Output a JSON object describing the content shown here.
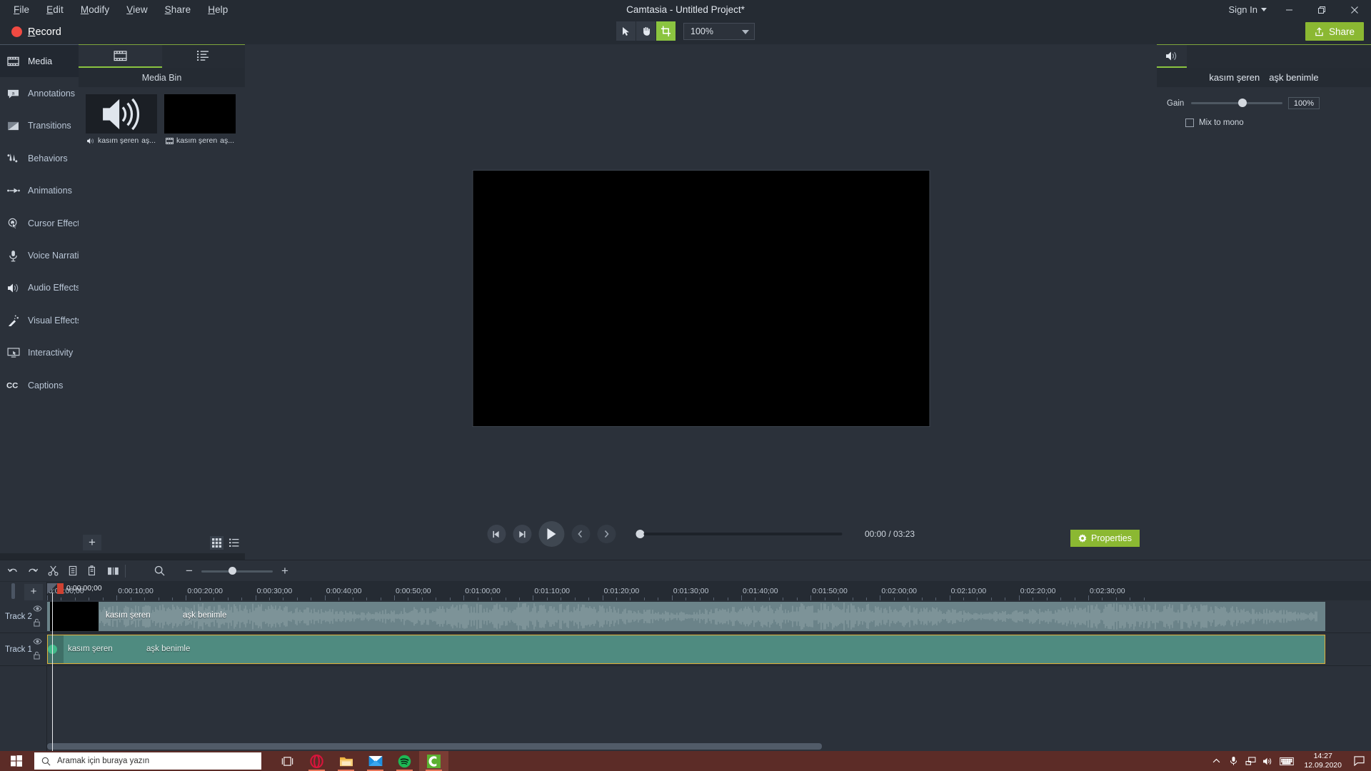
{
  "titlebar": {
    "menus": [
      {
        "label": "File",
        "accel": "F"
      },
      {
        "label": "Edit",
        "accel": "E"
      },
      {
        "label": "Modify",
        "accel": "M"
      },
      {
        "label": "View",
        "accel": "V"
      },
      {
        "label": "Share",
        "accel": "S"
      },
      {
        "label": "Help",
        "accel": "H"
      }
    ],
    "title": "Camtasia - Untitled Project*",
    "sign_in": "Sign In",
    "minimize": "—",
    "restore": "❐",
    "close": "✕"
  },
  "toolbar": {
    "record_label": "Record",
    "zoom_value": "100%",
    "share_label": "Share",
    "tools": [
      {
        "name": "select-tool",
        "active": false
      },
      {
        "name": "hand-tool",
        "active": false
      },
      {
        "name": "crop-tool",
        "active": true
      }
    ]
  },
  "sidebar": {
    "items": [
      {
        "label": "Media",
        "icon": "film-strip-icon",
        "active": true
      },
      {
        "label": "Annotations",
        "icon": "callout-icon",
        "active": false
      },
      {
        "label": "Transitions",
        "icon": "transition-icon",
        "active": false
      },
      {
        "label": "Behaviors",
        "icon": "behaviors-icon",
        "active": false
      },
      {
        "label": "Animations",
        "icon": "arrow-animation-icon",
        "active": false
      },
      {
        "label": "Cursor Effects",
        "icon": "cursor-effects-icon",
        "active": false
      },
      {
        "label": "Voice Narration",
        "icon": "microphone-icon",
        "active": false
      },
      {
        "label": "Audio Effects",
        "icon": "speaker-icon",
        "active": false
      },
      {
        "label": "Visual Effects",
        "icon": "magic-wand-icon",
        "active": false
      },
      {
        "label": "Interactivity",
        "icon": "interactivity-icon",
        "active": false
      },
      {
        "label": "Captions",
        "icon": "cc-icon",
        "active": false
      }
    ]
  },
  "media_bin": {
    "tabs": [
      {
        "name": "media-bin-tab",
        "icon": "film-strip-icon",
        "active": true
      },
      {
        "name": "library-tab",
        "icon": "list-icon",
        "active": false
      }
    ],
    "title": "Media Bin",
    "items": [
      {
        "main": "kasım şeren",
        "sub": "aş...",
        "icon": "speaker-icon",
        "type": "audio"
      },
      {
        "main": "kasım şeren",
        "sub": "aş...",
        "icon": "film-strip-icon",
        "type": "video"
      }
    ],
    "add_label": "+"
  },
  "canvas": {
    "playback": {
      "prev_frame": "prev-frame",
      "next_frame": "next-frame",
      "play": "play",
      "prev_marker": "previous",
      "next_marker": "next",
      "current_time": "00:00",
      "separator": "/",
      "total_time": "03:23"
    },
    "properties_label": "Properties"
  },
  "properties": {
    "tab_icon": "audio-properties-icon",
    "clip_name_main": "kasım şeren",
    "clip_name_sub": "aşk benimle",
    "gain_label": "Gain",
    "gain_value": "100%",
    "mix_to_mono_label": "Mix to mono",
    "mix_to_mono_checked": false
  },
  "timeline": {
    "tools": [
      {
        "name": "undo-button",
        "icon": "undo-icon"
      },
      {
        "name": "redo-button",
        "icon": "redo-icon"
      },
      {
        "name": "cut-button",
        "icon": "scissors-icon"
      },
      {
        "name": "copy-button",
        "icon": "copy-icon"
      },
      {
        "name": "paste-button",
        "icon": "paste-icon"
      },
      {
        "name": "split-button",
        "icon": "split-icon"
      },
      {
        "name": "zoom-tool-button",
        "icon": "magnifier-icon"
      }
    ],
    "zoom_out": "−",
    "zoom_in": "+",
    "playhead_time": "0:00:00;00",
    "add_track_label": "+",
    "ruler_labels": [
      "0:00:00;00",
      "0:00:10;00",
      "0:00:20;00",
      "0:00:30;00",
      "0:00:40;00",
      "0:00:50;00",
      "0:01:00;00",
      "0:01:10;00",
      "0:01:20;00",
      "0:01:30;00",
      "0:01:40;00",
      "0:01:50;00",
      "0:02:00;00",
      "0:02:10;00",
      "0:02:20;00",
      "0:02:30;00"
    ],
    "tracks": [
      {
        "name": "Track 2",
        "clip_main": "kasım şeren",
        "clip_sub": "aşk benimle",
        "type": "video",
        "selected": false
      },
      {
        "name": "Track 1",
        "clip_main": "kasım şeren",
        "clip_sub": "aşk benimle",
        "type": "audio",
        "selected": true
      }
    ]
  },
  "taskbar": {
    "search_placeholder": "Aramak için buraya yazın",
    "apps": [
      {
        "name": "task-view-icon",
        "running": false
      },
      {
        "name": "opera-icon",
        "running": true
      },
      {
        "name": "file-explorer-icon",
        "running": true
      },
      {
        "name": "mail-icon",
        "running": true
      },
      {
        "name": "spotify-icon",
        "running": true
      },
      {
        "name": "camtasia-icon",
        "running": true,
        "active": true
      }
    ],
    "clock_time": "14:27",
    "clock_date": "12.09.2020"
  },
  "colors": {
    "accent_green": "#8bc440",
    "record_red": "#f04a42",
    "panel_bg": "#2b313a",
    "titlebar_bg": "#252b33",
    "taskbar_bg": "#5c2c27",
    "clip_video": "#6b8389",
    "clip_audio": "#4f8b80",
    "selection_yellow": "#e0b23a"
  }
}
